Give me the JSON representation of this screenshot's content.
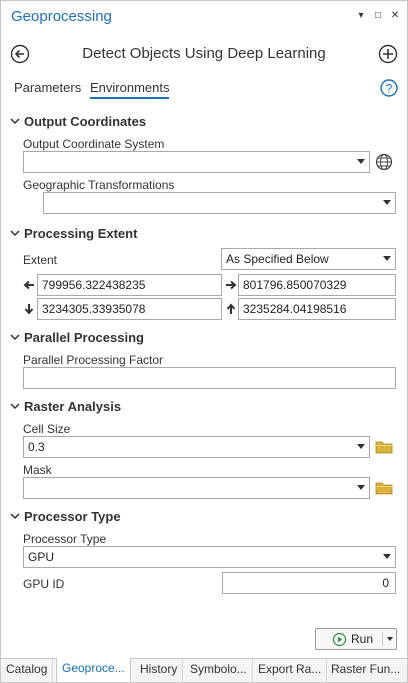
{
  "window": {
    "title": "Geoprocessing",
    "controls": [
      "▾",
      "□",
      "✕"
    ]
  },
  "tool": {
    "title": "Detect Objects Using Deep Learning",
    "back_icon": "back-arrow-icon",
    "add_icon": "add-icon"
  },
  "tabs": {
    "parameters": "Parameters",
    "environments": "Environments",
    "active": "Environments"
  },
  "sections": {
    "output_coordinates": {
      "title": "Output Coordinates",
      "output_cs_label": "Output Coordinate System",
      "output_cs_value": "",
      "geo_trans_label": "Geographic Transformations",
      "geo_trans_value": ""
    },
    "processing_extent": {
      "title": "Processing Extent",
      "extent_label": "Extent",
      "extent_value": "As Specified Below",
      "left": "799956.322438235",
      "right": "801796.850070329",
      "bottom": "3234305.33935078",
      "top": "3235284.04198516"
    },
    "parallel_processing": {
      "title": "Parallel Processing",
      "factor_label": "Parallel Processing Factor",
      "factor_value": ""
    },
    "raster_analysis": {
      "title": "Raster Analysis",
      "cell_size_label": "Cell Size",
      "cell_size_value": "0.3",
      "mask_label": "Mask",
      "mask_value": ""
    },
    "processor_type": {
      "title": "Processor Type",
      "processor_label": "Processor Type",
      "processor_value": "GPU",
      "gpu_id_label": "GPU ID",
      "gpu_id_value": "0"
    }
  },
  "run_button": {
    "label": "Run"
  },
  "bottom_tabs": [
    {
      "label": "Catalog"
    },
    {
      "label": "Geoproce..."
    },
    {
      "label": "History"
    },
    {
      "label": "Symbolo..."
    },
    {
      "label": "Export Ra..."
    },
    {
      "label": "Raster Fun..."
    }
  ],
  "colors": {
    "accent": "#1c6fb8",
    "folder": "#d9b13b",
    "run_green": "#2e8b3a"
  }
}
